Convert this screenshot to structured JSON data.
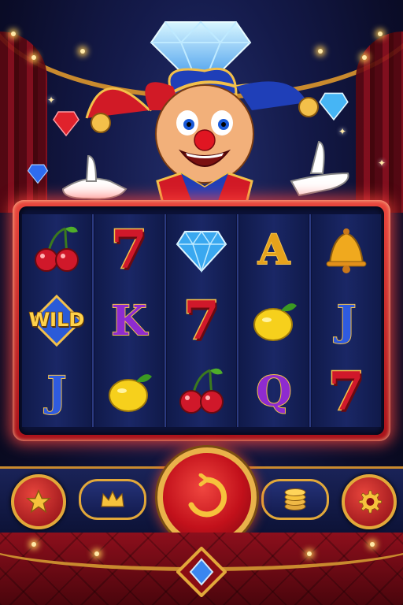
{
  "game": {
    "reels": [
      [
        {
          "type": "cherry",
          "label": ""
        },
        {
          "type": "wild",
          "label": "WILD"
        },
        {
          "type": "letter",
          "label": "J",
          "color": "#2f5be0"
        }
      ],
      [
        {
          "type": "seven",
          "label": "7"
        },
        {
          "type": "letter",
          "label": "K",
          "color": "#8e2bd0"
        },
        {
          "type": "lemon",
          "label": ""
        }
      ],
      [
        {
          "type": "diamond",
          "label": ""
        },
        {
          "type": "seven",
          "label": "7"
        },
        {
          "type": "cherry",
          "label": ""
        }
      ],
      [
        {
          "type": "letter",
          "label": "A",
          "color": "#e6a21c"
        },
        {
          "type": "lemon",
          "label": ""
        },
        {
          "type": "letter",
          "label": "Q",
          "color": "#8e2bd0"
        }
      ],
      [
        {
          "type": "bell",
          "label": ""
        },
        {
          "type": "letter",
          "label": "J",
          "color": "#2f5be0"
        },
        {
          "type": "seven",
          "label": "7"
        }
      ]
    ],
    "wild_label": "WILD"
  },
  "controls": {
    "favorites_icon": "star-icon",
    "vip_icon": "crown-icon",
    "spin_icon": "spin-icon",
    "bet_icon": "coins-icon",
    "settings_icon": "gear-icon"
  },
  "colors": {
    "frame_red": "#e8453c",
    "gold": "#e2a83a",
    "reel_bg": "#0c1238"
  }
}
